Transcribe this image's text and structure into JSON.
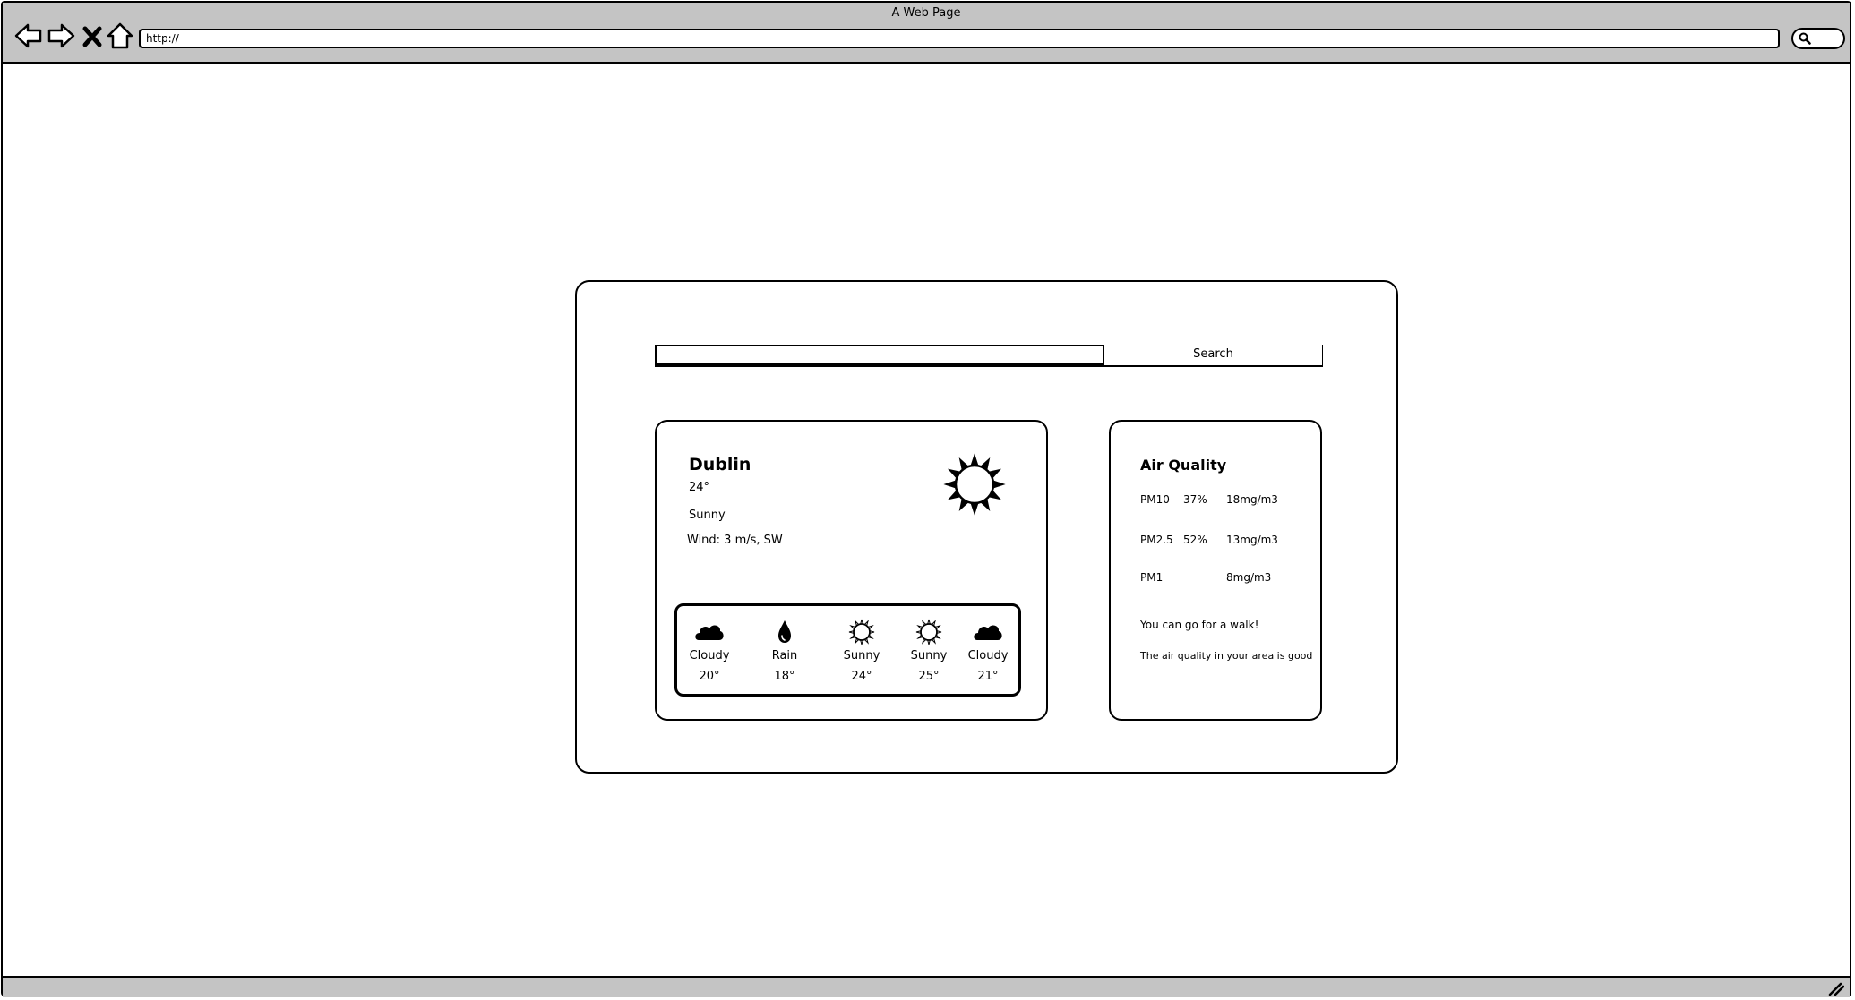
{
  "window": {
    "title": "A Web Page",
    "url": "http://"
  },
  "search": {
    "placeholder": "",
    "button_label": "Search"
  },
  "weather": {
    "city": "Dublin",
    "temperature": "24°",
    "condition": "Sunny",
    "wind": "Wind: 3 m/s, SW",
    "icon": "sun-icon",
    "forecast": [
      {
        "label": "Cloudy",
        "temp": "20°",
        "icon": "cloud-icon"
      },
      {
        "label": "Rain",
        "temp": "18°",
        "icon": "raindrop-icon"
      },
      {
        "label": "Sunny",
        "temp": "24°",
        "icon": "sun-icon"
      },
      {
        "label": "Sunny",
        "temp": "25°",
        "icon": "sun-icon"
      },
      {
        "label": "Cloudy",
        "temp": "21°",
        "icon": "cloud-icon"
      }
    ]
  },
  "air_quality": {
    "title": "Air Quality",
    "rows": [
      {
        "name": "PM10",
        "percent": "37%",
        "value": "18mg/m3"
      },
      {
        "name": "PM2.5",
        "percent": "52%",
        "value": "13mg/m3"
      },
      {
        "name": "PM1",
        "percent": "",
        "value": "8mg/m3"
      }
    ],
    "advice": "You can go for a walk!",
    "summary": "The air quality in your area is good"
  }
}
